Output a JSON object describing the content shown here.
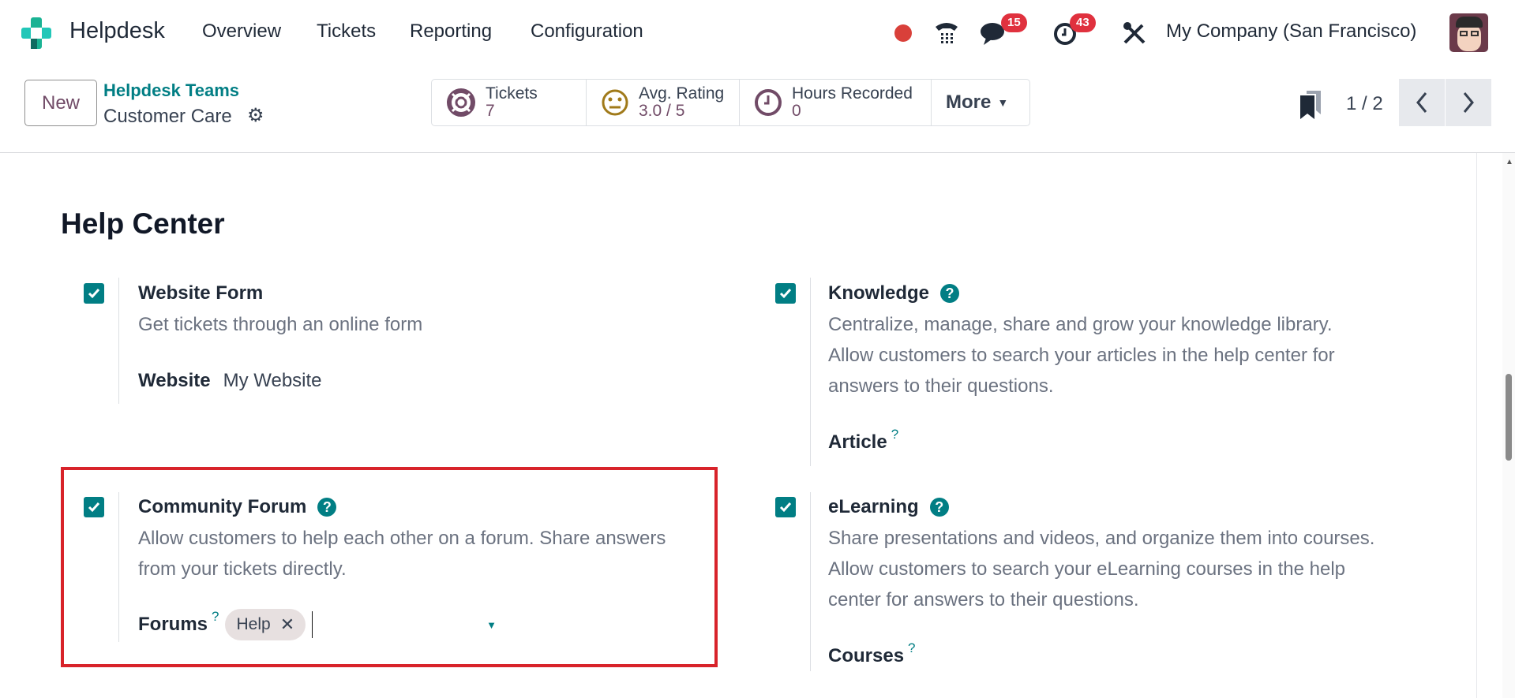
{
  "navbar": {
    "app_name": "Helpdesk",
    "menu": [
      "Overview",
      "Tickets",
      "Reporting",
      "Configuration"
    ],
    "messages_count": "15",
    "activities_count": "43",
    "company": "My Company (San Francisco)"
  },
  "control_panel": {
    "new_label": "New",
    "breadcrumb_parent": "Helpdesk Teams",
    "record_name": "Customer Care",
    "stats": [
      {
        "label": "Tickets",
        "value": "7"
      },
      {
        "label": "Avg. Rating",
        "value": "3.0 / 5"
      },
      {
        "label": "Hours Recorded",
        "value": "0"
      }
    ],
    "more_label": "More",
    "pager": "1 / 2"
  },
  "section": {
    "title": "Help Center",
    "settings": [
      {
        "title": "Website Form",
        "checked": true,
        "desc": [
          "Get tickets through an online form"
        ],
        "field_label": "Website",
        "field_value": "My Website"
      },
      {
        "title": "Knowledge",
        "checked": true,
        "desc": [
          "Centralize, manage, share and grow your knowledge library.",
          "Allow customers to search your articles in the help center for",
          "answers to their questions."
        ],
        "field_label": "Article"
      },
      {
        "title": "Community Forum",
        "checked": true,
        "desc": [
          "Allow customers to help each other on a forum. Share answers",
          "from your tickets directly."
        ],
        "field_label": "Forums",
        "tag": "Help"
      },
      {
        "title": "eLearning",
        "checked": true,
        "desc": [
          "Share presentations and videos, and organize them into courses.",
          "Allow customers to search your eLearning courses in the help",
          "center for answers to their questions."
        ],
        "field_label": "Courses"
      }
    ]
  },
  "colors": {
    "accent": "#017e84",
    "brand": "#714b67",
    "highlight": "#d8232a"
  }
}
